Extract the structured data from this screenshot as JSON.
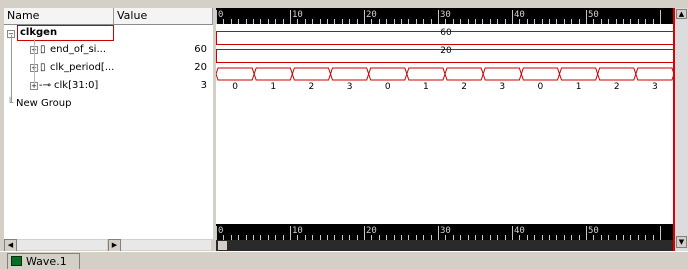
{
  "header": {
    "name_col": "Name",
    "value_col": "Value"
  },
  "signals": [
    {
      "name": "clkgen",
      "value": ""
    },
    {
      "name": "end_of_si...",
      "value": "60"
    },
    {
      "name": "clk_period[...",
      "value": "20"
    },
    {
      "name": "clk[31:0]",
      "value": "3"
    },
    {
      "name": "New Group",
      "value": ""
    }
  ],
  "ruler": {
    "ticks": [
      "0",
      "10",
      "20",
      "30",
      "40",
      "50"
    ]
  },
  "waves": {
    "end_of_sim": "60",
    "clk_period": "20",
    "clk_values": [
      "0",
      "1",
      "2",
      "3",
      "0",
      "1",
      "2",
      "3",
      "0",
      "1",
      "2",
      "3"
    ]
  },
  "tabs": {
    "wave_tab": "Wave.1"
  },
  "colors": {
    "wave": "#cc0000",
    "cursor": "#e00000",
    "selection": "#cc0000"
  }
}
